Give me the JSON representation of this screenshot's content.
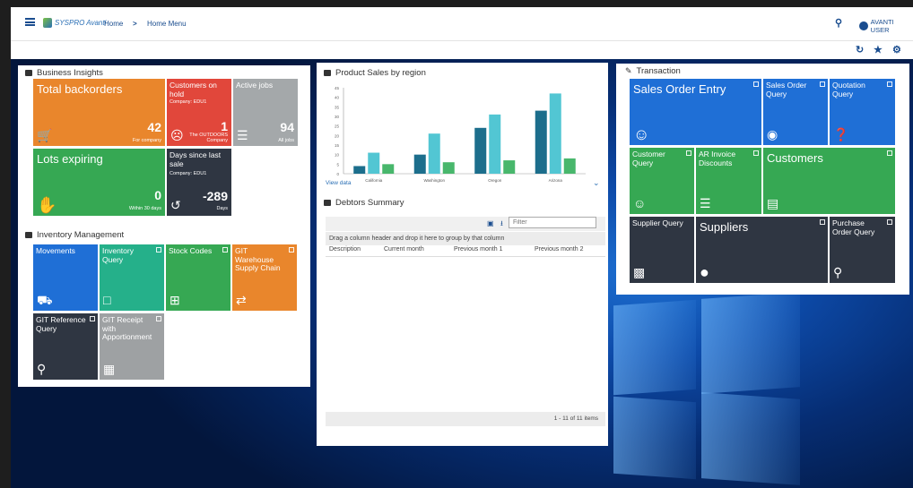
{
  "topbar": {
    "brand": "SYSPRO Avanti",
    "crumb_home": "Home",
    "crumb_sep": ">",
    "crumb_current": "Home Menu",
    "user": "AVANTI USER"
  },
  "business_insights": {
    "title": "Business Insights",
    "tiles": [
      {
        "title": "Total backorders",
        "value": "42",
        "caption": "For company"
      },
      {
        "title": "Customers on hold",
        "subtitle": "Company: EDU1",
        "value": "1",
        "caption": "The OUTDOORS Company"
      },
      {
        "title": "Active jobs",
        "value": "94",
        "caption": "All jobs"
      },
      {
        "title": "Lots expiring",
        "value": "0",
        "caption": "Within 30 days"
      },
      {
        "title": "Days since last sale",
        "subtitle": "Company: EDU1",
        "value": "-289",
        "caption": "Days"
      }
    ]
  },
  "inventory": {
    "title": "Inventory Management",
    "tiles": [
      {
        "title": "Movements"
      },
      {
        "title": "Inventory Query"
      },
      {
        "title": "Stock Codes"
      },
      {
        "title": "GIT Warehouse Supply Chain"
      },
      {
        "title": "GIT Reference Query"
      },
      {
        "title": "GIT Receipt with Apportionment"
      }
    ]
  },
  "product_sales": {
    "title": "Product Sales by region",
    "view_data": "View data"
  },
  "chart_data": {
    "type": "bar",
    "categories": [
      "California",
      "Washington",
      "Oregon",
      "Arizona"
    ],
    "series": [
      {
        "values": [
          4,
          10,
          24,
          33
        ],
        "color": "#1c6e8c"
      },
      {
        "values": [
          11,
          21,
          31,
          42
        ],
        "color": "#52c6d3"
      },
      {
        "values": [
          5,
          6,
          7,
          8
        ],
        "color": "#48b76c"
      }
    ],
    "ylim": [
      0,
      45
    ],
    "yticks": [
      0,
      5,
      10,
      15,
      20,
      25,
      30,
      35,
      40,
      45
    ],
    "grid": false
  },
  "debtors": {
    "title": "Debtors Summary",
    "filter_placeholder": "Filter",
    "group_hint": "Drag a column header and drop it here to group by that column",
    "columns": [
      "Description",
      "Current month",
      "Previous month 1",
      "Previous month 2"
    ],
    "footer": "1 - 11 of 11 items"
  },
  "transaction": {
    "title": "Transaction",
    "tiles": [
      {
        "title": "Sales Order Entry"
      },
      {
        "title": "Sales Order Query"
      },
      {
        "title": "Quotation Query"
      },
      {
        "title": "Customer Query"
      },
      {
        "title": "AR Invoice Discounts"
      },
      {
        "title": "Customers"
      },
      {
        "title": "Supplier Query"
      },
      {
        "title": "Suppliers"
      },
      {
        "title": "Purchase Order Query"
      }
    ]
  }
}
